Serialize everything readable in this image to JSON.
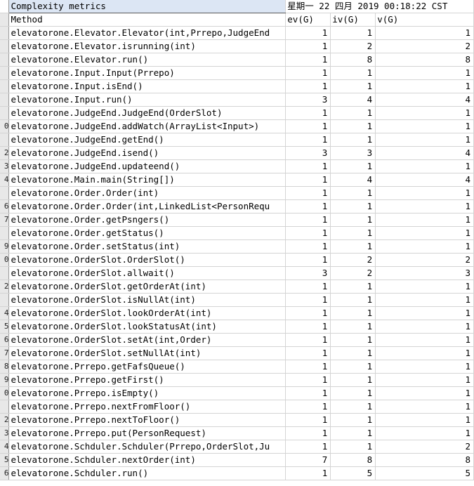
{
  "header": {
    "title": "Complexity metrics",
    "date": "星期一 22 四月 2019 00:18:22 CST"
  },
  "columns": [
    "Method",
    "ev(G)",
    "iv(G)",
    "v(G)"
  ],
  "rows": [
    [
      "elevatorone.Elevator.Elevator(int,Prrepo,JudgeEnd",
      "1",
      "1",
      "1"
    ],
    [
      "elevatorone.Elevator.isrunning(int)",
      "1",
      "2",
      "2"
    ],
    [
      "elevatorone.Elevator.run()",
      "1",
      "8",
      "8"
    ],
    [
      "elevatorone.Input.Input(Prrepo)",
      "1",
      "1",
      "1"
    ],
    [
      "elevatorone.Input.isEnd()",
      "1",
      "1",
      "1"
    ],
    [
      "elevatorone.Input.run()",
      "3",
      "4",
      "4"
    ],
    [
      "elevatorone.JudgeEnd.JudgeEnd(OrderSlot)",
      "1",
      "1",
      "1"
    ],
    [
      "elevatorone.JudgeEnd.addWatch(ArrayList<Input>)",
      "1",
      "1",
      "1"
    ],
    [
      "elevatorone.JudgeEnd.getEnd()",
      "1",
      "1",
      "1"
    ],
    [
      "elevatorone.JudgeEnd.isend()",
      "3",
      "3",
      "4"
    ],
    [
      "elevatorone.JudgeEnd.updateend()",
      "1",
      "1",
      "1"
    ],
    [
      "elevatorone.Main.main(String[])",
      "1",
      "4",
      "4"
    ],
    [
      "elevatorone.Order.Order(int)",
      "1",
      "1",
      "1"
    ],
    [
      "elevatorone.Order.Order(int,LinkedList<PersonRequ",
      "1",
      "1",
      "1"
    ],
    [
      "elevatorone.Order.getPsngers()",
      "1",
      "1",
      "1"
    ],
    [
      "elevatorone.Order.getStatus()",
      "1",
      "1",
      "1"
    ],
    [
      "elevatorone.Order.setStatus(int)",
      "1",
      "1",
      "1"
    ],
    [
      "elevatorone.OrderSlot.OrderSlot()",
      "1",
      "2",
      "2"
    ],
    [
      "elevatorone.OrderSlot.allwait()",
      "3",
      "2",
      "3"
    ],
    [
      "elevatorone.OrderSlot.getOrderAt(int)",
      "1",
      "1",
      "1"
    ],
    [
      "elevatorone.OrderSlot.isNullAt(int)",
      "1",
      "1",
      "1"
    ],
    [
      "elevatorone.OrderSlot.lookOrderAt(int)",
      "1",
      "1",
      "1"
    ],
    [
      "elevatorone.OrderSlot.lookStatusAt(int)",
      "1",
      "1",
      "1"
    ],
    [
      "elevatorone.OrderSlot.setAt(int,Order)",
      "1",
      "1",
      "1"
    ],
    [
      "elevatorone.OrderSlot.setNullAt(int)",
      "1",
      "1",
      "1"
    ],
    [
      "elevatorone.Prrepo.getFafsQueue()",
      "1",
      "1",
      "1"
    ],
    [
      "elevatorone.Prrepo.getFirst()",
      "1",
      "1",
      "1"
    ],
    [
      "elevatorone.Prrepo.isEmpty()",
      "1",
      "1",
      "1"
    ],
    [
      "elevatorone.Prrepo.nextFromFloor()",
      "1",
      "1",
      "1"
    ],
    [
      "elevatorone.Prrepo.nextToFloor()",
      "1",
      "1",
      "1"
    ],
    [
      "elevatorone.Prrepo.put(PersonRequest)",
      "1",
      "1",
      "1"
    ],
    [
      "elevatorone.Schduler.Schduler(Prrepo,OrderSlot,Ju",
      "1",
      "1",
      "2"
    ],
    [
      "elevatorone.Schduler.nextOrder(int)",
      "7",
      "8",
      "8"
    ],
    [
      "elevatorone.Schduler.run()",
      "1",
      "5",
      "5"
    ]
  ],
  "row_numbers": [
    "",
    "",
    "",
    "",
    "",
    "",
    "",
    "",
    "",
    "0",
    "",
    "2",
    "3",
    "4",
    "",
    "6",
    "7",
    "",
    "9",
    "0",
    "",
    "2",
    "",
    "4",
    "5",
    "6",
    "7",
    "8",
    "9",
    "0",
    "",
    "2",
    "3",
    "4",
    "5",
    "6"
  ]
}
